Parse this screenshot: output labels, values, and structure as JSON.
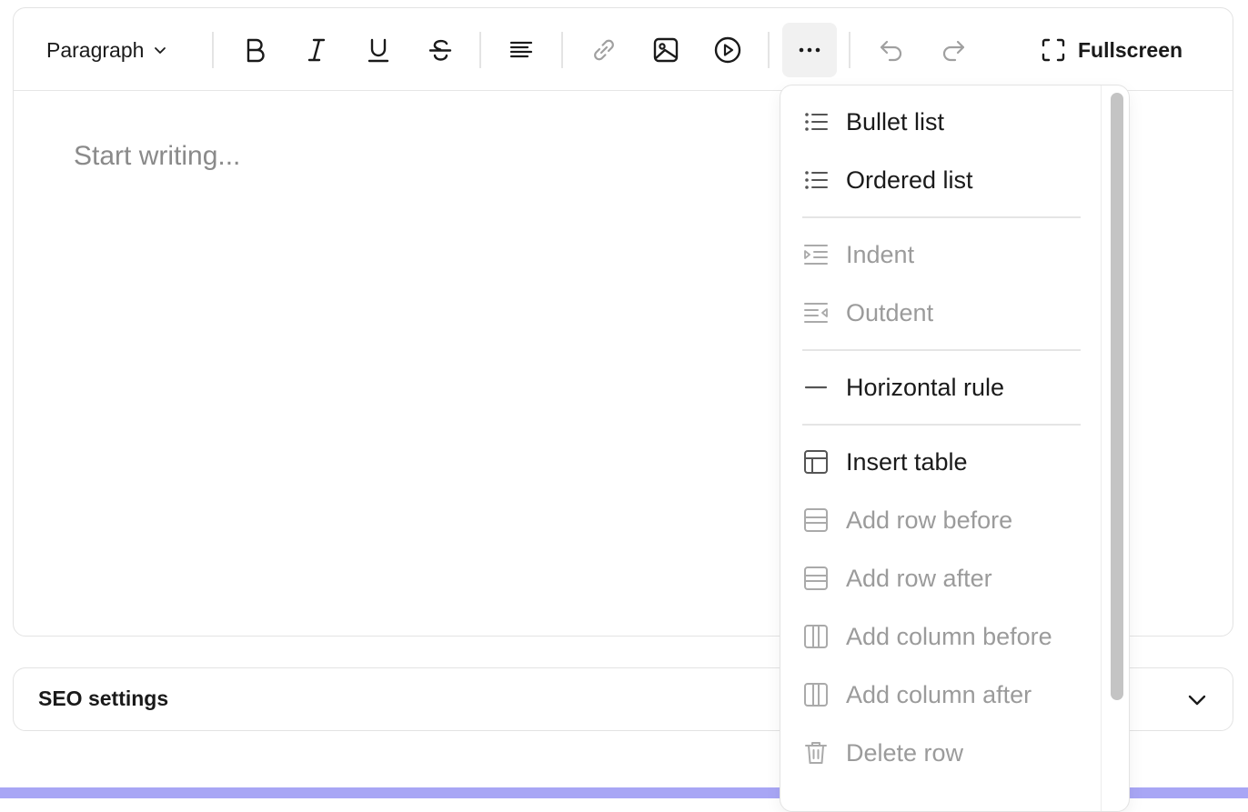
{
  "toolbar": {
    "block_type": "Paragraph",
    "fullscreen_label": "Fullscreen"
  },
  "editor": {
    "placeholder": "Start writing..."
  },
  "seo": {
    "label": "SEO settings"
  },
  "more_menu": {
    "items": [
      {
        "label": "Bullet list",
        "icon": "bullet-list-icon",
        "enabled": true
      },
      {
        "label": "Ordered list",
        "icon": "ordered-list-icon",
        "enabled": true
      },
      {
        "label": "Indent",
        "icon": "indent-icon",
        "enabled": false
      },
      {
        "label": "Outdent",
        "icon": "outdent-icon",
        "enabled": false
      },
      {
        "label": "Horizontal rule",
        "icon": "horizontal-rule-icon",
        "enabled": true
      },
      {
        "label": "Insert table",
        "icon": "table-icon",
        "enabled": true
      },
      {
        "label": "Add row before",
        "icon": "row-icon",
        "enabled": false
      },
      {
        "label": "Add row after",
        "icon": "row-icon",
        "enabled": false
      },
      {
        "label": "Add column before",
        "icon": "column-icon",
        "enabled": false
      },
      {
        "label": "Add column after",
        "icon": "column-icon",
        "enabled": false
      },
      {
        "label": "Delete row",
        "icon": "trash-icon",
        "enabled": false
      }
    ]
  },
  "colors": {
    "accent_bar": "#a8a6f5",
    "disabled_text": "#9b9b9b",
    "border": "#e3e3e3"
  }
}
